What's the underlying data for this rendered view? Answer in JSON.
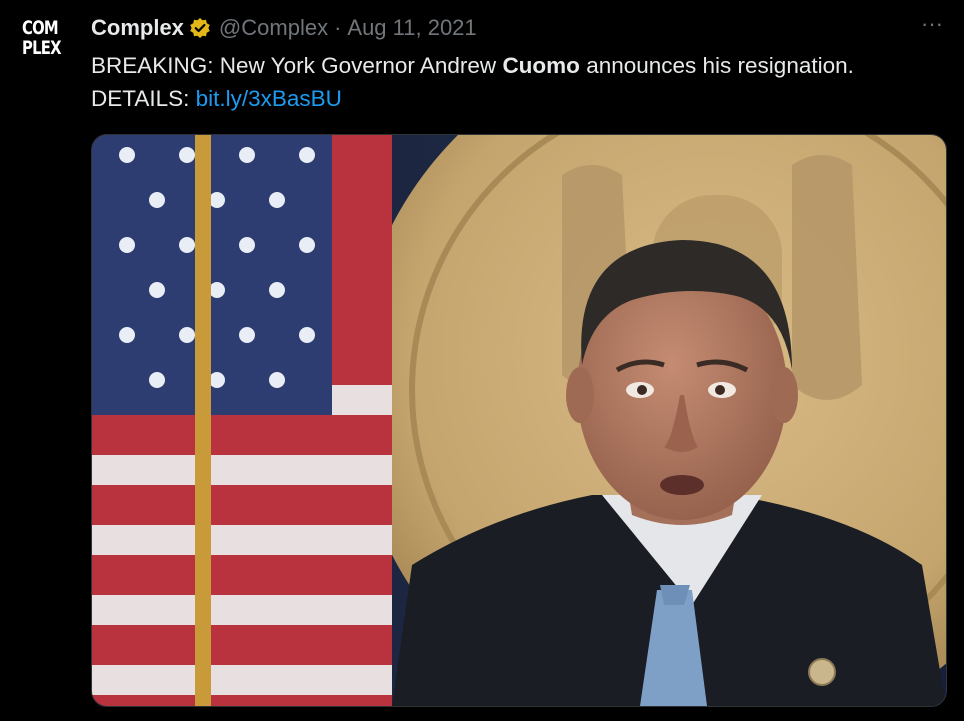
{
  "avatar": {
    "line1": "COM",
    "line2": "PLEX"
  },
  "tweet": {
    "display_name": "Complex",
    "handle": "@Complex",
    "separator": "·",
    "date": "Aug 11, 2021",
    "text_before": "BREAKING: New York Governor Andrew ",
    "text_bold": "Cuomo",
    "text_after": " announces his resignation.",
    "details_label": "DETAILS: ",
    "link": "bit.ly/3xBasBU",
    "more_label": "···"
  },
  "icons": {
    "verified": "verified-badge-icon",
    "more": "more-options-icon"
  },
  "colors": {
    "background": "#000000",
    "text": "#e7e9ea",
    "secondary": "#71767b",
    "link": "#1d9bf0",
    "verified_gold": "#e2b719"
  }
}
